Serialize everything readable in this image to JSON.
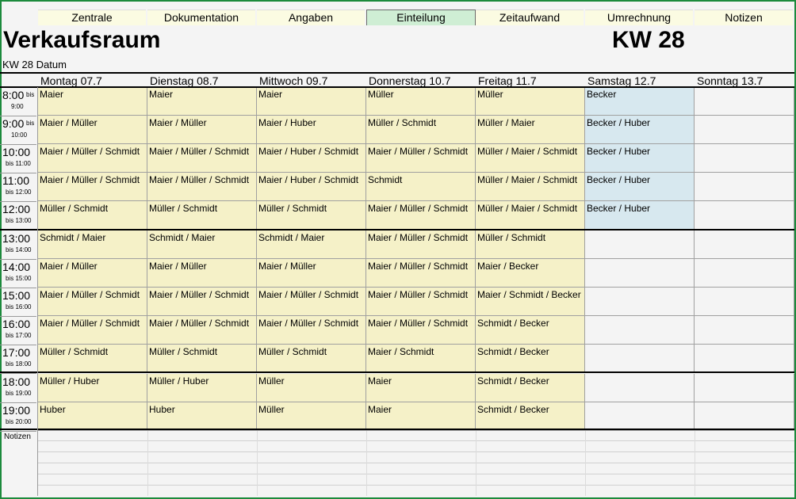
{
  "tabs": [
    "Zentrale",
    "Dokumentation",
    "Angaben",
    "Einteilung",
    "Zeitaufwand",
    "Umrechnung",
    "Notizen"
  ],
  "active_tab": "Einteilung",
  "header": {
    "title": "Verkaufsraum",
    "week": "KW 28",
    "subtitle": "KW 28 Datum"
  },
  "days": [
    "Montag 07.7",
    "Dienstag 08.7",
    "Mittwoch 09.7",
    "Donnerstag 10.7",
    "Freitag 11.7",
    "Samstag 12.7",
    "Sonntag 13.7"
  ],
  "times": [
    {
      "start": "8:00",
      "end": "9:00"
    },
    {
      "start": "9:00",
      "end": "10:00"
    },
    {
      "start": "10:00",
      "end": "bis 11:00"
    },
    {
      "start": "11:00",
      "end": "bis 12:00"
    },
    {
      "start": "12:00",
      "end": "bis 13:00"
    },
    {
      "start": "13:00",
      "end": "bis 14:00"
    },
    {
      "start": "14:00",
      "end": "bis 15:00"
    },
    {
      "start": "15:00",
      "end": "bis 16:00"
    },
    {
      "start": "16:00",
      "end": "bis 17:00"
    },
    {
      "start": "17:00",
      "end": "bis 18:00"
    },
    {
      "start": "18:00",
      "end": "bis 19:00"
    },
    {
      "start": "19:00",
      "end": "bis 20:00"
    }
  ],
  "bis_label": "bis",
  "schedule": [
    [
      "Maier",
      "Maier",
      "Maier",
      "Müller",
      "Müller",
      "Becker",
      ""
    ],
    [
      "Maier / Müller",
      "Maier / Müller",
      "Maier / Huber",
      "Müller / Schmidt",
      "Müller / Maier",
      "Becker / Huber",
      ""
    ],
    [
      "Maier / Müller / Schmidt",
      "Maier / Müller / Schmidt",
      "Maier / Huber / Schmidt",
      "Maier / Müller / Schmidt",
      "Müller / Maier / Schmidt",
      "Becker / Huber",
      ""
    ],
    [
      "Maier / Müller / Schmidt",
      "Maier / Müller / Schmidt",
      "Maier / Huber / Schmidt",
      "Schmidt",
      "Müller / Maier / Schmidt",
      "Becker / Huber",
      ""
    ],
    [
      "Müller / Schmidt",
      "Müller / Schmidt",
      "Müller / Schmidt",
      "Maier / Müller / Schmidt",
      "Müller / Maier / Schmidt",
      "Becker / Huber",
      ""
    ],
    [
      "Schmidt / Maier",
      "Schmidt / Maier",
      "Schmidt / Maier",
      "Maier / Müller / Schmidt",
      "Müller / Schmidt",
      "",
      ""
    ],
    [
      "Maier / Müller",
      "Maier / Müller",
      "Maier / Müller",
      "Maier / Müller / Schmidt",
      "Maier / Becker",
      "",
      ""
    ],
    [
      "Maier / Müller / Schmidt",
      "Maier / Müller / Schmidt",
      "Maier / Müller / Schmidt",
      "Maier / Müller / Schmidt",
      "Maier / Schmidt / Becker",
      "",
      ""
    ],
    [
      "Maier / Müller / Schmidt",
      "Maier / Müller / Schmidt",
      "Maier / Müller / Schmidt",
      "Maier / Müller / Schmidt",
      "Schmidt / Becker",
      "",
      ""
    ],
    [
      "Müller / Schmidt",
      "Müller / Schmidt",
      "Müller / Schmidt",
      "Maier / Schmidt",
      "Schmidt / Becker",
      "",
      ""
    ],
    [
      "Müller / Huber",
      "Müller / Huber",
      "Müller",
      "Maier",
      "Schmidt / Becker",
      "",
      ""
    ],
    [
      "Huber",
      "Huber",
      "Müller",
      "Maier",
      "Schmidt / Becker",
      "",
      ""
    ]
  ],
  "notes_label": "Notizen",
  "colors": {
    "frame": "#1c8a3c",
    "weekday_cell": "#f5f1c8",
    "saturday_cell": "#d7e8ef",
    "active_tab": "#cfeed4"
  }
}
